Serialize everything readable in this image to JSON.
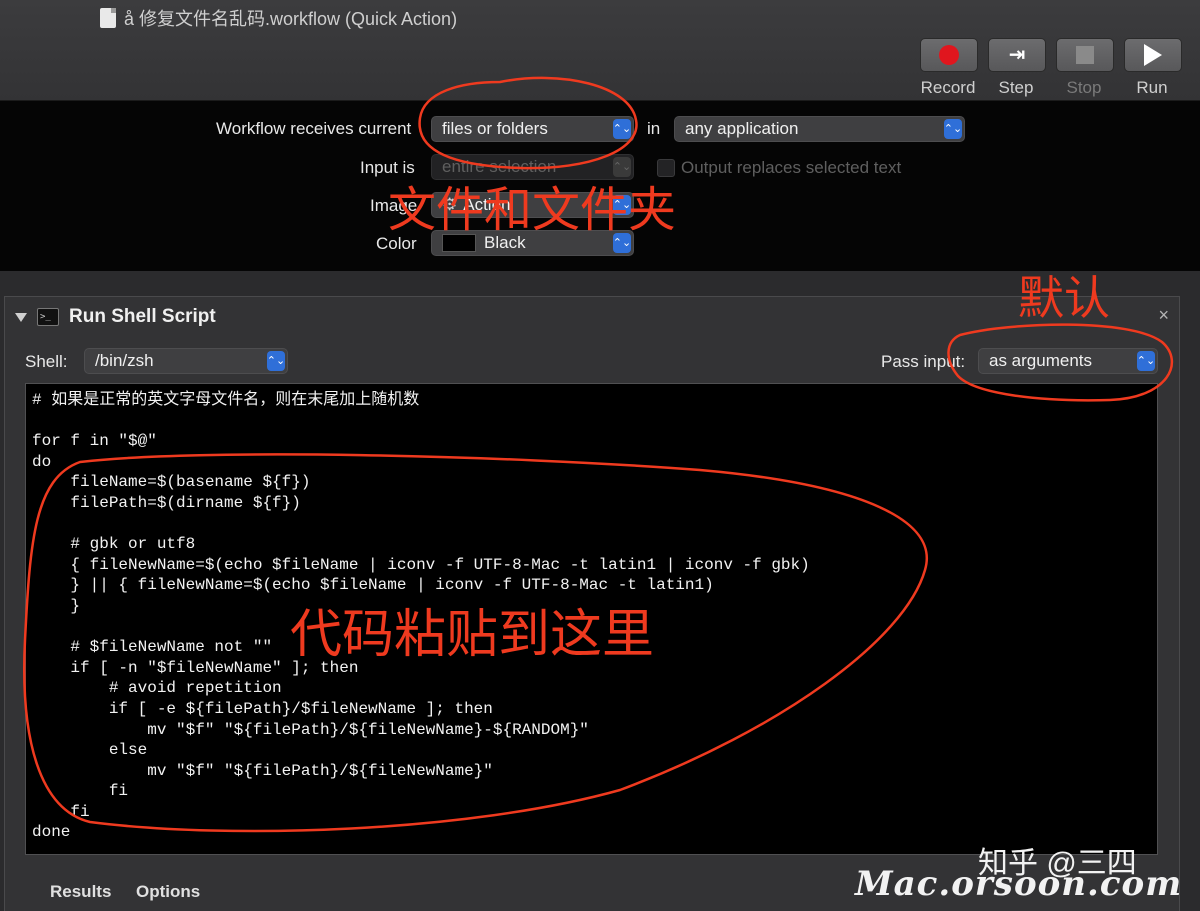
{
  "window": {
    "title": "å 修复文件名乱码.workflow (Quick Action)",
    "doc_icon": "document-icon"
  },
  "toolbar": {
    "record_label": "Record",
    "step_label": "Step",
    "stop_label": "Stop",
    "run_label": "Run"
  },
  "workflow_options": {
    "receives_label": "Workflow receives current",
    "receives_value": "files or folders",
    "in_label": "in",
    "application_value": "any application",
    "input_is_label": "Input is",
    "input_is_value": "entire selection",
    "output_replaces_label": "Output replaces selected text",
    "image_label": "Image",
    "image_value": "Action",
    "color_label": "Color",
    "color_value": "Black",
    "color_swatch": "#000000"
  },
  "action": {
    "title": "Run Shell Script",
    "close_glyph": "×",
    "shell_label": "Shell:",
    "shell_value": "/bin/zsh",
    "pass_input_label": "Pass input:",
    "pass_input_value": "as arguments",
    "code_lines": [
      "# 如果是正常的英文字母文件名，则在末尾加上随机数",
      "",
      "for f in \"$@\"",
      "do",
      "    fileName=$(basename ${f})",
      "    filePath=$(dirname ${f})",
      "",
      "    # gbk or utf8",
      "    { fileNewName=$(echo $fileName | iconv -f UTF-8-Mac -t latin1 | iconv -f gbk)",
      "    } || { fileNewName=$(echo $fileName | iconv -f UTF-8-Mac -t latin1)",
      "    }",
      "",
      "    # $fileNewName not \"\"",
      "    if [ -n \"$fileNewName\" ]; then",
      "        # avoid repetition",
      "        if [ -e ${filePath}/$fileNewName ]; then",
      "            mv \"$f\" \"${filePath}/${fileNewName}-${RANDOM}\"",
      "        else",
      "            mv \"$f\" \"${filePath}/${fileNewName}\"",
      "        fi",
      "    fi",
      "done"
    ],
    "tabs": [
      "Results",
      "Options"
    ]
  },
  "annotations": {
    "files_and_folders": "文件和文件夹",
    "default": "默认",
    "paste_code_here": "代码粘贴到这里",
    "color": "#ef3a1f"
  },
  "watermarks": {
    "zhihu": "知乎 @三四",
    "site": "Mac.orsoon.com"
  }
}
